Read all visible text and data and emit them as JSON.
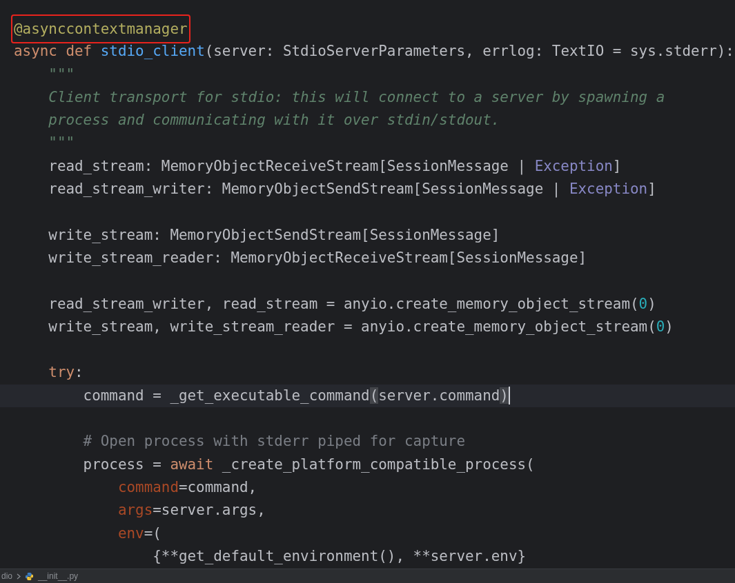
{
  "editor": {
    "lines": [
      {
        "kind": "code",
        "boxed": true,
        "current": false,
        "tokens": [
          {
            "kind": "decorator",
            "text": "@asynccontextmanager"
          }
        ]
      },
      {
        "kind": "code",
        "boxed": false,
        "current": false,
        "tokens": [
          {
            "kind": "keyword",
            "text": "async def "
          },
          {
            "kind": "function",
            "text": "stdio_client"
          },
          {
            "kind": "plain",
            "text": "(server: StdioServerParameters, errlog: TextIO = sys.stderr):"
          }
        ]
      },
      {
        "kind": "code",
        "boxed": false,
        "current": false,
        "tokens": [
          {
            "kind": "docstring",
            "text": "    \"\"\""
          }
        ]
      },
      {
        "kind": "code",
        "boxed": false,
        "current": false,
        "tokens": [
          {
            "kind": "docstring",
            "text": "    Client transport for stdio: this will connect to a server by spawning a"
          }
        ]
      },
      {
        "kind": "code",
        "boxed": false,
        "current": false,
        "tokens": [
          {
            "kind": "docstring",
            "text": "    process and communicating with it over stdin/stdout."
          }
        ]
      },
      {
        "kind": "code",
        "boxed": false,
        "current": false,
        "tokens": [
          {
            "kind": "docstring",
            "text": "    \"\"\""
          }
        ]
      },
      {
        "kind": "code",
        "boxed": false,
        "current": false,
        "tokens": [
          {
            "kind": "plain",
            "text": "    read_stream: MemoryObjectReceiveStream[SessionMessage | "
          },
          {
            "kind": "builtin",
            "text": "Exception"
          },
          {
            "kind": "plain",
            "text": "]"
          }
        ]
      },
      {
        "kind": "code",
        "boxed": false,
        "current": false,
        "tokens": [
          {
            "kind": "plain",
            "text": "    read_stream_writer: MemoryObjectSendStream[SessionMessage | "
          },
          {
            "kind": "builtin",
            "text": "Exception"
          },
          {
            "kind": "plain",
            "text": "]"
          }
        ]
      },
      {
        "kind": "blank"
      },
      {
        "kind": "code",
        "boxed": false,
        "current": false,
        "tokens": [
          {
            "kind": "plain",
            "text": "    write_stream: MemoryObjectSendStream[SessionMessage]"
          }
        ]
      },
      {
        "kind": "code",
        "boxed": false,
        "current": false,
        "tokens": [
          {
            "kind": "plain",
            "text": "    write_stream_reader: MemoryObjectReceiveStream[SessionMessage]"
          }
        ]
      },
      {
        "kind": "blank"
      },
      {
        "kind": "code",
        "boxed": false,
        "current": false,
        "tokens": [
          {
            "kind": "plain",
            "text": "    read_stream_writer, read_stream = anyio.create_memory_object_stream("
          },
          {
            "kind": "number",
            "text": "0"
          },
          {
            "kind": "plain",
            "text": ")"
          }
        ]
      },
      {
        "kind": "code",
        "boxed": false,
        "current": false,
        "tokens": [
          {
            "kind": "plain",
            "text": "    write_stream, write_stream_reader = anyio.create_memory_object_stream("
          },
          {
            "kind": "number",
            "text": "0"
          },
          {
            "kind": "plain",
            "text": ")"
          }
        ]
      },
      {
        "kind": "blank"
      },
      {
        "kind": "code",
        "boxed": false,
        "current": false,
        "tokens": [
          {
            "kind": "keyword",
            "text": "    try"
          },
          {
            "kind": "plain",
            "text": ":"
          }
        ]
      },
      {
        "kind": "code",
        "boxed": false,
        "current": true,
        "tokens": [
          {
            "kind": "plain",
            "text": "        command = _get_executable_command"
          },
          {
            "kind": "brace_match",
            "text": "("
          },
          {
            "kind": "plain",
            "text": "server.command"
          },
          {
            "kind": "brace_match",
            "text": ")"
          }
        ]
      },
      {
        "kind": "blank"
      },
      {
        "kind": "code",
        "boxed": false,
        "current": false,
        "tokens": [
          {
            "kind": "comment",
            "text": "        # Open process with stderr piped for capture"
          }
        ]
      },
      {
        "kind": "code",
        "boxed": false,
        "current": false,
        "tokens": [
          {
            "kind": "plain",
            "text": "        process = "
          },
          {
            "kind": "keyword",
            "text": "await"
          },
          {
            "kind": "plain",
            "text": " _create_platform_compatible_process("
          }
        ]
      },
      {
        "kind": "code",
        "boxed": false,
        "current": false,
        "tokens": [
          {
            "kind": "named_arg",
            "text": "            command"
          },
          {
            "kind": "plain",
            "text": "=command,"
          }
        ]
      },
      {
        "kind": "code",
        "boxed": false,
        "current": false,
        "tokens": [
          {
            "kind": "named_arg",
            "text": "            args"
          },
          {
            "kind": "plain",
            "text": "=server.args,"
          }
        ]
      },
      {
        "kind": "code",
        "boxed": false,
        "current": false,
        "tokens": [
          {
            "kind": "named_arg",
            "text": "            env"
          },
          {
            "kind": "plain",
            "text": "=("
          }
        ]
      },
      {
        "kind": "code",
        "boxed": false,
        "current": false,
        "tokens": [
          {
            "kind": "plain",
            "text": "                {**get_default_environment(), **server.env}"
          }
        ]
      }
    ]
  },
  "breadcrumb": {
    "folder": "dio",
    "file": "__init__.py"
  }
}
